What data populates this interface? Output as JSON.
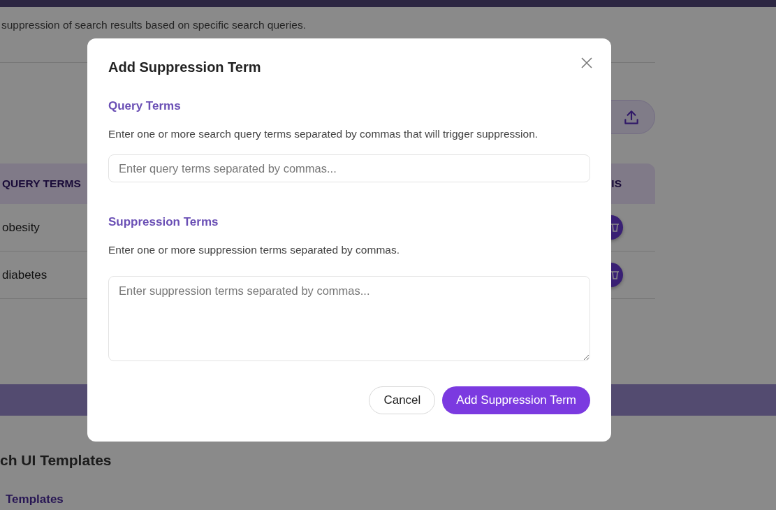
{
  "page": {
    "description": "suppression of search results based on specific search queries.",
    "table": {
      "columns": [
        "QUERY TERMS",
        "IS"
      ],
      "rows": [
        {
          "query": "obesity"
        },
        {
          "query": "diabetes"
        }
      ]
    },
    "section_title": "ch UI Templates",
    "subsection_title": "Templates"
  },
  "dialog": {
    "title": "Add Suppression Term",
    "fields": [
      {
        "kind": "input",
        "label": "Query Terms",
        "help": "Enter one or more search query terms separated by commas that will trigger suppression.",
        "placeholder": "Enter query terms separated by commas..."
      },
      {
        "kind": "textarea",
        "label": "Suppression Terms",
        "help": "Enter one or more suppression terms separated by commas.",
        "placeholder": "Enter suppression terms separated by commas..."
      }
    ],
    "buttons": [
      {
        "label": "Cancel",
        "kind": "secondary"
      },
      {
        "label": "Add Suppression Term",
        "kind": "primary"
      }
    ]
  }
}
